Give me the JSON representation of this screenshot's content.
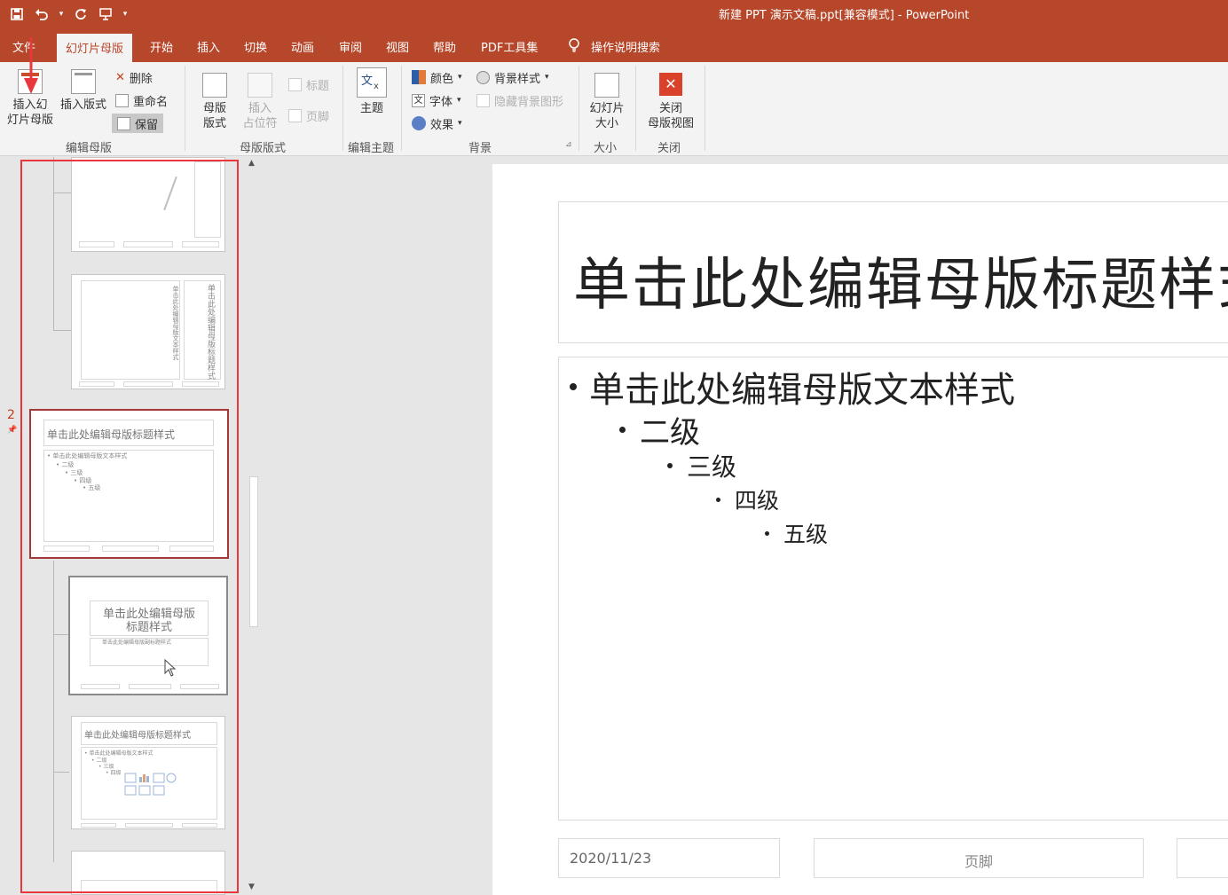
{
  "app": {
    "title": "新建 PPT 演示文稿.ppt[兼容模式]  -  PowerPoint"
  },
  "tabs": [
    "文件",
    "幻灯片母版",
    "开始",
    "插入",
    "切换",
    "动画",
    "审阅",
    "视图",
    "帮助",
    "PDF工具集"
  ],
  "tell_me": "操作说明搜索",
  "ribbon": {
    "groups": [
      "编辑母版",
      "母版版式",
      "编辑主题",
      "背景",
      "大小",
      "关闭"
    ],
    "insert_master": [
      "插入幻",
      "灯片母版"
    ],
    "insert_layout": "插入版式",
    "delete": "删除",
    "rename": "重命名",
    "preserve": "保留",
    "master_layout": [
      "母版",
      "版式"
    ],
    "insert_placeholder": [
      "插入",
      "占位符"
    ],
    "title_check": "标题",
    "footer_check": "页脚",
    "themes": "主题",
    "colors": "颜色",
    "fonts": "字体",
    "effects": "效果",
    "background_styles": "背景样式",
    "hide_bg": "隐藏背景图形",
    "slide_size": [
      "幻灯片",
      "大小"
    ],
    "close_master": [
      "关闭",
      "母版视图"
    ]
  },
  "thumbnails": {
    "slide_number": "2",
    "master_title": "单击此处编辑母版标题样式",
    "master_body": "• 单击此处编辑母版文本样式",
    "levels": [
      "• 二级",
      "• 三级",
      "• 四级",
      "• 五级"
    ],
    "title_layout_title": [
      "单击此处编辑母版",
      "标题样式"
    ],
    "title_layout_sub": "单击此处编辑母版副标题样式",
    "content_layout_title": "单击此处编辑母版标题样式",
    "content_layout_body": "• 单击此处编辑母版文本样式",
    "vertical_text_a": "单击此处编辑母版文本样式",
    "vertical_title_b": "单击此处编辑母版标题样式"
  },
  "slide": {
    "title": "单击此处编辑母版标题样式",
    "body": [
      {
        "level": 1,
        "text": "单击此处编辑母版文本样式"
      },
      {
        "level": 2,
        "text": "二级"
      },
      {
        "level": 3,
        "text": "三级"
      },
      {
        "level": 4,
        "text": "四级"
      },
      {
        "level": 5,
        "text": "五级"
      }
    ],
    "date": "2020/11/23",
    "footer": "页脚"
  },
  "colors": {
    "accent": "#b7472a",
    "highlight": "#e8383d",
    "selected_border": "#a4373a"
  }
}
